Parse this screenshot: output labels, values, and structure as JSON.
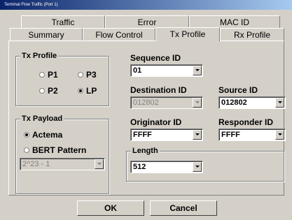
{
  "window": {
    "title": "Terminal Flow Traffic (Port 1)"
  },
  "tabs_row1": [
    {
      "label": "Traffic"
    },
    {
      "label": "Error"
    },
    {
      "label": "MAC ID"
    }
  ],
  "tabs_row2": [
    {
      "label": "Summary"
    },
    {
      "label": "Flow Control"
    },
    {
      "label": "Tx Profile"
    },
    {
      "label": "Rx Profile"
    }
  ],
  "tx_profile": {
    "legend": "Tx Profile",
    "options": [
      {
        "label": "P1",
        "selected": false
      },
      {
        "label": "P3",
        "selected": false
      },
      {
        "label": "P2",
        "selected": false
      },
      {
        "label": "LP",
        "selected": true
      }
    ]
  },
  "tx_payload": {
    "legend": "Tx Payload",
    "options": [
      {
        "label": "Actema",
        "selected": true
      },
      {
        "label": "BERT Pattern",
        "selected": false
      }
    ],
    "bert_value": "2^23 - 1"
  },
  "fields": {
    "sequence_id": {
      "label": "Sequence ID",
      "value": "01"
    },
    "destination_id": {
      "label": "Destination ID",
      "value": "012802"
    },
    "source_id": {
      "label": "Source ID",
      "value": "012802"
    },
    "originator_id": {
      "label": "Originator ID",
      "value": "FFFF"
    },
    "responder_id": {
      "label": "Responder ID",
      "value": "FFFF"
    },
    "length": {
      "label": "Length",
      "value": "512"
    }
  },
  "buttons": {
    "ok": "OK",
    "cancel": "Cancel"
  }
}
